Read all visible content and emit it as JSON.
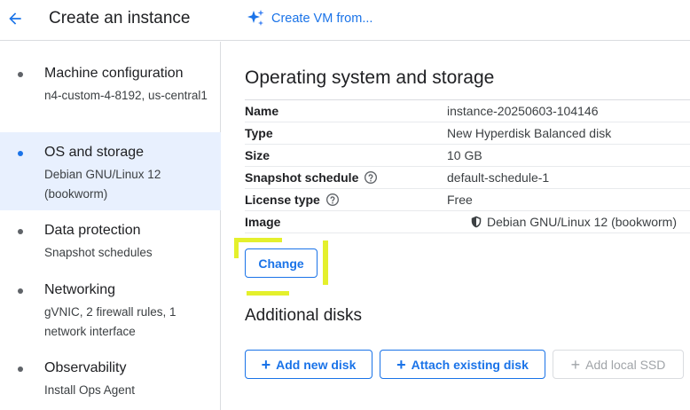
{
  "header": {
    "title": "Create an instance",
    "create_vm_label": "Create VM from..."
  },
  "nav": {
    "items": [
      {
        "title": "Machine configuration",
        "subtitle": "n4-custom-4-8192, us-central1",
        "selected": false
      },
      {
        "title": "OS and storage",
        "subtitle": "Debian GNU/Linux 12 (bookworm)",
        "selected": true
      },
      {
        "title": "Data protection",
        "subtitle": "Snapshot schedules",
        "selected": false
      },
      {
        "title": "Networking",
        "subtitle": "gVNIC, 2 firewall rules, 1 network interface",
        "selected": false
      },
      {
        "title": "Observability",
        "subtitle": "Install Ops Agent",
        "selected": false
      }
    ]
  },
  "main": {
    "section_title": "Operating system and storage",
    "details": [
      {
        "label": "Name",
        "value": "instance-20250603-104146"
      },
      {
        "label": "Type",
        "value": "New Hyperdisk Balanced disk"
      },
      {
        "label": "Size",
        "value": "10 GB"
      },
      {
        "label": "Snapshot schedule",
        "value": "default-schedule-1"
      },
      {
        "label": "License type",
        "value": "Free"
      },
      {
        "label": "Image",
        "value": "Debian GNU/Linux 12 (bookworm)"
      }
    ],
    "change_label": "Change",
    "additional_disks_title": "Additional disks",
    "add_new_disk_label": "Add new disk",
    "attach_existing_disk_label": "Attach existing disk",
    "add_local_ssd_label": "Add local SSD"
  },
  "colors": {
    "accent": "#1a73e8",
    "selected_nav_bg": "#e8f0fe",
    "highlight": "#e4f02c"
  },
  "icons": {
    "back": "arrow-left-icon",
    "create_vm": "sparkle-icon",
    "help": "help-circle-icon",
    "image": "shield-icon",
    "add": "plus-icon"
  }
}
